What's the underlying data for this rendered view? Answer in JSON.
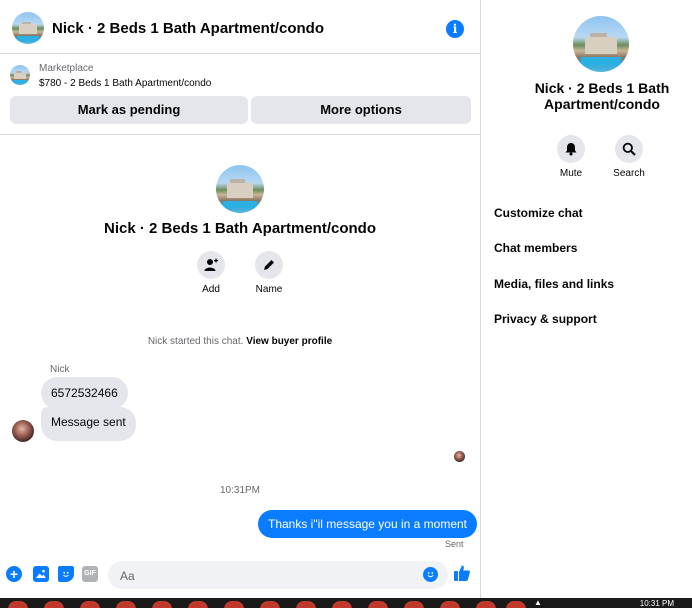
{
  "header": {
    "title": "Nick · 2 Beds 1 Bath Apartment/condo",
    "info_icon": "info-icon"
  },
  "listing": {
    "label": "Marketplace",
    "price_title": "$780 - 2 Beds 1 Bath Apartment/condo",
    "pending_button": "Mark as pending",
    "more_button": "More options"
  },
  "profile": {
    "name": "Nick · 2 Beds 1 Bath Apartment/condo",
    "add_label": "Add",
    "name_label": "Name"
  },
  "conversation": {
    "system_text": "Nick started this chat.",
    "system_link": "View buyer profile",
    "sender": "Nick",
    "incoming": [
      "6572532466",
      "Message sent"
    ],
    "timestamp": "10:31PM",
    "outgoing": "Thanks i\"il message you in a moment",
    "status": "Sent"
  },
  "composer": {
    "placeholder": "Aa",
    "gif_label": "GIF"
  },
  "panel": {
    "name_line1": "Nick · 2 Beds 1 Bath",
    "name_line2": "Apartment/condo",
    "mute_label": "Mute",
    "search_label": "Search",
    "menu": [
      "Customize chat",
      "Chat members",
      "Media, files and links",
      "Privacy & support"
    ]
  },
  "taskbar": {
    "clock": "10:31 PM"
  },
  "colors": {
    "accent": "#0a7cff",
    "bubble_incoming": "#e4e6eb",
    "secondary_text": "#65676b"
  }
}
